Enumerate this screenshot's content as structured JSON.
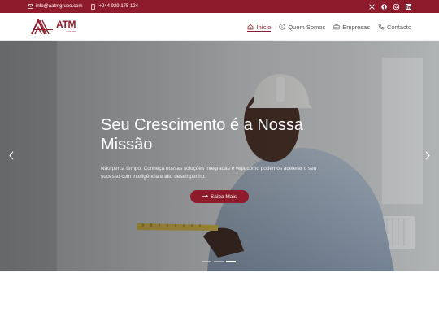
{
  "topbar": {
    "email": "info@aatmgrupo.com",
    "phone": "+244 929 175 124",
    "email_icon": "mail-icon",
    "phone_icon": "phone-icon",
    "social": [
      "x-icon",
      "facebook-icon",
      "instagram-icon",
      "linkedin-icon"
    ],
    "color": "#8e1b2b"
  },
  "logo": {
    "text": "ATM",
    "subtext": "GRUPO"
  },
  "nav": {
    "items": [
      {
        "label": "Início",
        "icon": "home-icon",
        "active": true
      },
      {
        "label": "Quem Somos",
        "icon": "info-icon",
        "active": false
      },
      {
        "label": "Empresas",
        "icon": "briefcase-icon",
        "active": false
      },
      {
        "label": "Contacto",
        "icon": "phone-icon",
        "active": false
      }
    ]
  },
  "hero": {
    "title": "Seu Crescimento é a Nossa Missão",
    "text": "Não perca tempo. Conheça nossas soluções integradas e veja como podemos acelerar o seu sucesso com inteligência e alto desempenho.",
    "button_label": "Saiba Mais",
    "button_icon": "arrow-right-icon",
    "slides": 3,
    "active_slide": 3,
    "accent": "#8e1b2b"
  }
}
